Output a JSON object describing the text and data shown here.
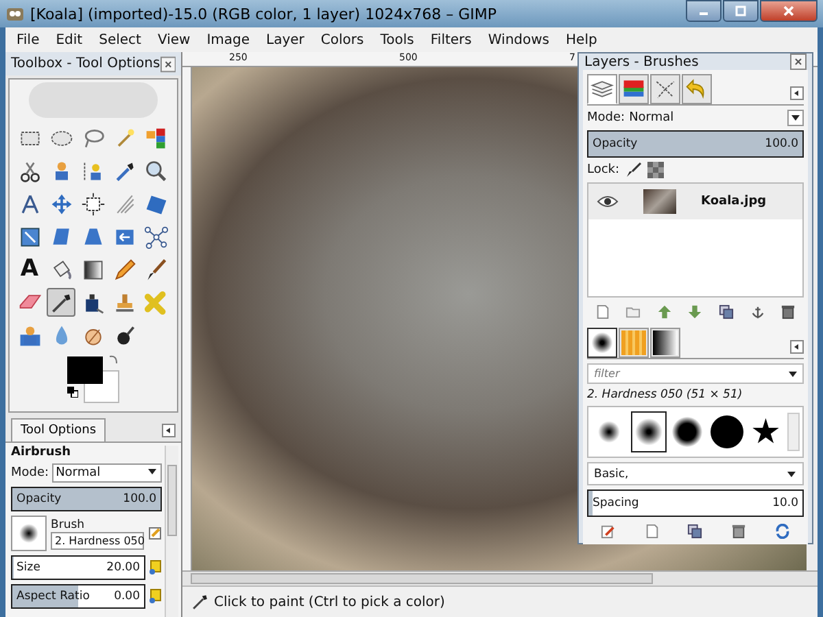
{
  "window": {
    "title": "[Koala] (imported)-15.0 (RGB color, 1 layer) 1024x768 – GIMP"
  },
  "menu": [
    "File",
    "Edit",
    "Select",
    "View",
    "Image",
    "Layer",
    "Colors",
    "Tools",
    "Filters",
    "Windows",
    "Help"
  ],
  "toolbox": {
    "title": "Toolbox - Tool Options",
    "tools": [
      {
        "selected": false
      },
      {
        "selected": false
      },
      {
        "selected": false
      },
      {
        "selected": false
      },
      {
        "selected": false
      },
      {
        "selected": false
      },
      {
        "selected": false
      },
      {
        "selected": false
      },
      {
        "selected": false
      },
      {
        "selected": false
      },
      {
        "selected": false
      },
      {
        "selected": false
      },
      {
        "selected": false
      },
      {
        "selected": false
      },
      {
        "selected": false
      },
      {
        "selected": false
      },
      {
        "selected": false
      },
      {
        "selected": false
      },
      {
        "selected": false
      },
      {
        "selected": false
      },
      {
        "selected": false,
        "glyph": "A"
      },
      {
        "selected": false
      },
      {
        "selected": false
      },
      {
        "selected": false
      },
      {
        "selected": false
      },
      {
        "selected": false
      },
      {
        "selected": true
      },
      {
        "selected": false
      },
      {
        "selected": false
      },
      {
        "selected": false
      },
      {
        "selected": false
      },
      {
        "selected": false
      },
      {
        "selected": false
      },
      {
        "selected": false
      }
    ]
  },
  "tool_options": {
    "tab": "Tool Options",
    "tool": "Airbrush",
    "mode_label": "Mode:",
    "mode": "Normal",
    "fields": [
      {
        "kind": "slider",
        "label": "Opacity",
        "value": "100.0",
        "level": 1
      },
      {
        "kind": "brush",
        "label": "Brush",
        "value": "2. Hardness 050"
      },
      {
        "kind": "slider",
        "label": "Size",
        "value": "20.00",
        "level": 0.01
      },
      {
        "kind": "slider",
        "label": "Aspect Ratio",
        "value": "0.00",
        "level": 0.5
      }
    ]
  },
  "canvas": {
    "ruler_labels": [
      "250",
      "500",
      "7"
    ],
    "status": "Click to paint (Ctrl to pick a color)"
  },
  "layers_dock": {
    "title": "Layers - Brushes",
    "tabs": [
      {
        "selected": true
      },
      {
        "selected": false
      },
      {
        "selected": false
      },
      {
        "selected": false
      }
    ],
    "mode_label": "Mode:",
    "mode": "Normal",
    "opacity": {
      "label": "Opacity",
      "value": "100.0",
      "level": 1
    },
    "lock_label": "Lock:",
    "layers": [
      {
        "name": "Koala.jpg",
        "visible": true
      }
    ],
    "brush_tabs": [
      {
        "selected": true
      },
      {
        "selected": false
      },
      {
        "selected": false
      }
    ],
    "filter": {
      "placeholder": "filter"
    },
    "brush_name": "2. Hardness 050 (51 × 51)",
    "brushes": [
      {
        "selected": false
      },
      {
        "selected": true
      },
      {
        "selected": false
      },
      {
        "selected": false
      },
      {
        "selected": false
      }
    ],
    "brush_set": "Basic,",
    "spacing": {
      "label": "Spacing",
      "value": "10.0",
      "level": 0.02
    }
  }
}
